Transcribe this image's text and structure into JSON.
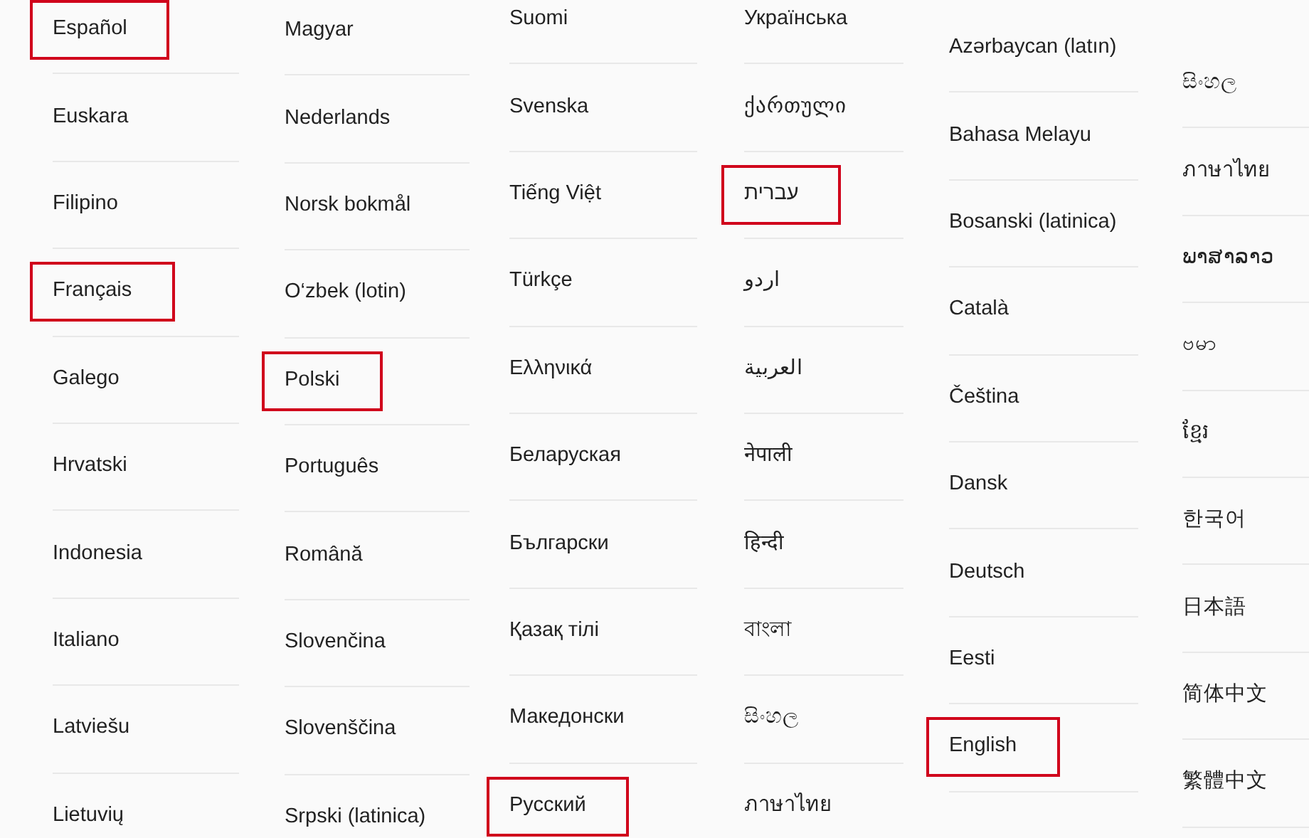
{
  "panels": [
    {
      "columns": [
        {
          "items": [
            {
              "label": "Español",
              "highlighted": true
            },
            {
              "label": "Euskara",
              "highlighted": false
            },
            {
              "label": "Filipino",
              "highlighted": false
            },
            {
              "label": "Français",
              "highlighted": true
            },
            {
              "label": "Galego",
              "highlighted": false
            },
            {
              "label": "Hrvatski",
              "highlighted": false
            },
            {
              "label": "Indonesia",
              "highlighted": false
            },
            {
              "label": "Italiano",
              "highlighted": false
            },
            {
              "label": "Latviešu",
              "highlighted": false
            },
            {
              "label": "Lietuvių",
              "highlighted": false
            }
          ]
        },
        {
          "items": [
            {
              "label": "Magyar",
              "highlighted": false
            },
            {
              "label": "Nederlands",
              "highlighted": false
            },
            {
              "label": "Norsk bokmål",
              "highlighted": false
            },
            {
              "label": "O‘zbek (lotin)",
              "highlighted": false
            },
            {
              "label": "Polski",
              "highlighted": true
            },
            {
              "label": "Português",
              "highlighted": false
            },
            {
              "label": "Română",
              "highlighted": false
            },
            {
              "label": "Slovenčina",
              "highlighted": false
            },
            {
              "label": "Slovenščina",
              "highlighted": false
            },
            {
              "label": "Srpski (latinica)",
              "highlighted": false
            }
          ]
        }
      ]
    },
    {
      "columns": [
        {
          "items": [
            {
              "label": "Suomi",
              "highlighted": false
            },
            {
              "label": "Svenska",
              "highlighted": false
            },
            {
              "label": "Tiếng Việt",
              "highlighted": false
            },
            {
              "label": "Türkçe",
              "highlighted": false
            },
            {
              "label": "Ελληνικά",
              "highlighted": false
            },
            {
              "label": "Беларуская",
              "highlighted": false
            },
            {
              "label": "Български",
              "highlighted": false
            },
            {
              "label": "Қазақ тілі",
              "highlighted": false
            },
            {
              "label": "Македонски",
              "highlighted": false
            },
            {
              "label": "Русский",
              "highlighted": true
            }
          ]
        },
        {
          "items": [
            {
              "label": "Українська",
              "highlighted": false
            },
            {
              "label": "ქართული",
              "highlighted": false
            },
            {
              "label": "עברית",
              "highlighted": true
            },
            {
              "label": "اردو",
              "highlighted": false
            },
            {
              "label": "العربية",
              "highlighted": false
            },
            {
              "label": "नेपाली",
              "highlighted": false
            },
            {
              "label": "हिन्दी",
              "highlighted": false
            },
            {
              "label": "বাংলা",
              "highlighted": false
            },
            {
              "label": "සිංහල",
              "highlighted": false
            },
            {
              "label": "ภาษาไทย",
              "highlighted": false
            }
          ]
        }
      ]
    },
    {
      "columns": [
        {
          "items": [
            {
              "label": "Azərbaycan (latın)",
              "highlighted": false
            },
            {
              "label": "Bahasa Melayu",
              "highlighted": false
            },
            {
              "label": "Bosanski (latinica)",
              "highlighted": false
            },
            {
              "label": "Català",
              "highlighted": false
            },
            {
              "label": "Čeština",
              "highlighted": false
            },
            {
              "label": "Dansk",
              "highlighted": false
            },
            {
              "label": "Deutsch",
              "highlighted": false
            },
            {
              "label": "Eesti",
              "highlighted": false
            },
            {
              "label": "English",
              "highlighted": true
            }
          ]
        },
        {
          "items": [
            {
              "label": "සිංහල",
              "highlighted": false
            },
            {
              "label": "ภาษาไทย",
              "highlighted": false
            },
            {
              "label": "ພາສາລາວ",
              "highlighted": false
            },
            {
              "label": "ဗမာ",
              "highlighted": false
            },
            {
              "label": "ខ្មែរ",
              "highlighted": false
            },
            {
              "label": "한국어",
              "highlighted": false
            },
            {
              "label": "日本語",
              "highlighted": false
            },
            {
              "label": "简体中文",
              "highlighted": false
            },
            {
              "label": "繁體中文",
              "highlighted": false
            }
          ]
        }
      ]
    }
  ]
}
